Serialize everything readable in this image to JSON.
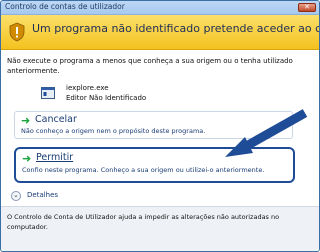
{
  "window": {
    "title": "Controlo de contas de utilizador"
  },
  "banner": {
    "heading": "Um programa não identificado pretende aceder ao computador"
  },
  "warning_text": "Não execute o programa a menos que conheça a sua origem ou o tenha utilizado anteriormente.",
  "program": {
    "name": "iexplore.exe",
    "publisher": "Editor Não Identificado"
  },
  "options": {
    "cancel": {
      "title": "Cancelar",
      "desc": "Não conheço a origem nem o propósito deste programa."
    },
    "allow": {
      "title": "Permitir",
      "desc": "Confio neste programa. Conheço a sua origem ou utilizei-o anteriormente."
    }
  },
  "details_label": "Detalhes",
  "footer_text": "O Controlo de Conta de Utilizador ajuda a impedir as alterações não autorizadas no computador.",
  "colors": {
    "banner": "#f4c21f",
    "accent_arrow": "#1f4c96",
    "option_text": "#1a3c74",
    "option_arrow": "#1aa33b"
  }
}
